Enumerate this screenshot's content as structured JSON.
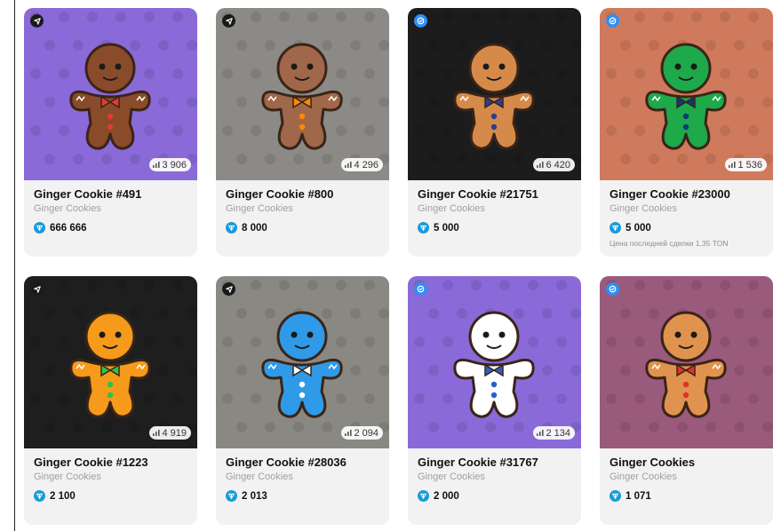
{
  "cards": [
    {
      "title": "Ginger Cookie #491",
      "collection": "Ginger Cookies",
      "price": "666 666",
      "views": "3 906",
      "badge": "dark",
      "bg": "#8a6ad8",
      "body": "#8a4b2a",
      "accent": "#e53935",
      "note": ""
    },
    {
      "title": "Ginger Cookie #800",
      "collection": "Ginger Cookies",
      "price": "8 000",
      "views": "4 296",
      "badge": "dark",
      "bg": "#8b8a86",
      "body": "#a0674a",
      "accent": "#ff8a00",
      "note": ""
    },
    {
      "title": "Ginger Cookie #21751",
      "collection": "Ginger Cookies",
      "price": "5 000",
      "views": "6 420",
      "badge": "blue",
      "bg": "#1c1c1c",
      "body": "#d68a4a",
      "accent": "#2a3f8f",
      "note": ""
    },
    {
      "title": "Ginger Cookie #23000",
      "collection": "Ginger Cookies",
      "price": "5 000",
      "views": "1 536",
      "badge": "blue",
      "bg": "#cf7a5c",
      "body": "#1ea94b",
      "accent": "#0c3a7a",
      "note": "Цена последней сделки 1,35 TON"
    },
    {
      "title": "Ginger Cookie #1223",
      "collection": "Ginger Cookies",
      "price": "2 100",
      "views": "4 919",
      "badge": "dark",
      "bg": "#1e1e1e",
      "body": "#f59a1a",
      "accent": "#2cc44a",
      "note": ""
    },
    {
      "title": "Ginger Cookie #28036",
      "collection": "Ginger Cookies",
      "price": "2 013",
      "views": "2 094",
      "badge": "dark",
      "bg": "#8a8882",
      "body": "#2f9ae8",
      "accent": "#ffffff",
      "note": ""
    },
    {
      "title": "Ginger Cookie #31767",
      "collection": "Ginger Cookies",
      "price": "2 000",
      "views": "2 134",
      "badge": "blue",
      "bg": "#8a6ad8",
      "body": "#ffffff",
      "accent": "#2b5fc4",
      "note": ""
    },
    {
      "title": "Ginger Cookies",
      "collection": "Ginger Cookies",
      "price": "1 071",
      "views": "",
      "badge": "blue",
      "bg": "#9a5a7c",
      "body": "#e0934e",
      "accent": "#e03030",
      "note": ""
    }
  ]
}
